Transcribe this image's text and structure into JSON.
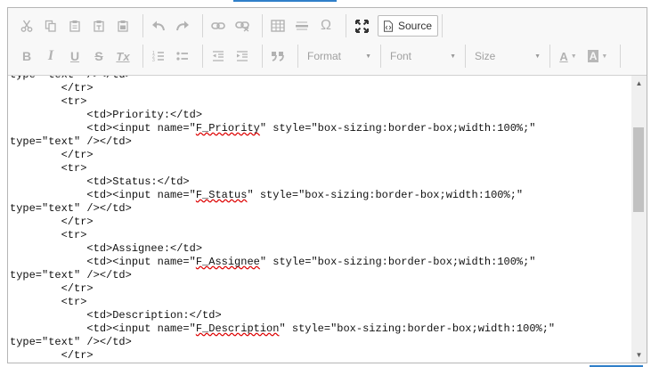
{
  "toolbar": {
    "row1": {
      "clipboard": [
        "cut-icon",
        "copy-icon",
        "paste-icon",
        "paste-text-icon",
        "paste-word-icon"
      ],
      "history": [
        "undo-icon",
        "redo-icon"
      ],
      "links": [
        "link-icon",
        "unlink-icon"
      ],
      "insert": [
        "table-icon",
        "horizontal-rule-icon"
      ],
      "special_char_glyph": "Ω",
      "maximize_icon": "maximize-icon",
      "source_label": "Source"
    },
    "row2": {
      "bold": "B",
      "italic": "I",
      "underline": "U",
      "strike": "S",
      "clear_format": "Tx",
      "format_label": "Format",
      "font_label": "Font",
      "size_label": "Size",
      "text_color_glyph": "A",
      "bg_color_glyph": "A"
    }
  },
  "editor": {
    "mode": "source",
    "lines": [
      {
        "parts": [
          {
            "t": "type=\"text\" /></td>"
          }
        ]
      },
      {
        "parts": [
          {
            "t": "        </tr>"
          }
        ]
      },
      {
        "parts": [
          {
            "t": "        <tr>"
          }
        ]
      },
      {
        "parts": [
          {
            "t": "            <td>Priority:</td>"
          }
        ]
      },
      {
        "parts": [
          {
            "t": "            <td><input name=\""
          },
          {
            "t": "F_Priority",
            "sq": true
          },
          {
            "t": "\" style=\"box-sizing:border-box;width:100%;\""
          }
        ]
      },
      {
        "parts": [
          {
            "t": "type=\"text\" /></td>"
          }
        ]
      },
      {
        "parts": [
          {
            "t": "        </tr>"
          }
        ]
      },
      {
        "parts": [
          {
            "t": "        <tr>"
          }
        ]
      },
      {
        "parts": [
          {
            "t": "            <td>Status:</td>"
          }
        ]
      },
      {
        "parts": [
          {
            "t": "            <td><input name=\""
          },
          {
            "t": "F_Status",
            "sq": true
          },
          {
            "t": "\" style=\"box-sizing:border-box;width:100%;\""
          }
        ]
      },
      {
        "parts": [
          {
            "t": "type=\"text\" /></td>"
          }
        ]
      },
      {
        "parts": [
          {
            "t": "        </tr>"
          }
        ]
      },
      {
        "parts": [
          {
            "t": "        <tr>"
          }
        ]
      },
      {
        "parts": [
          {
            "t": "            <td>Assignee:</td>"
          }
        ]
      },
      {
        "parts": [
          {
            "t": "            <td><input name=\""
          },
          {
            "t": "F_Assignee",
            "sq": true
          },
          {
            "t": "\" style=\"box-sizing:border-box;width:100%;\""
          }
        ]
      },
      {
        "parts": [
          {
            "t": "type=\"text\" /></td>"
          }
        ]
      },
      {
        "parts": [
          {
            "t": "        </tr>"
          }
        ]
      },
      {
        "parts": [
          {
            "t": "        <tr>"
          }
        ]
      },
      {
        "parts": [
          {
            "t": "            <td>Description:</td>"
          }
        ]
      },
      {
        "parts": [
          {
            "t": "            <td><input name=\""
          },
          {
            "t": "F_Description",
            "sq": true
          },
          {
            "t": "\" style=\"box-sizing:border-box;width:100%;\""
          }
        ]
      },
      {
        "parts": [
          {
            "t": "type=\"text\" /></td>"
          }
        ]
      },
      {
        "parts": [
          {
            "t": "        </tr>"
          }
        ]
      }
    ]
  },
  "scrollbar": {
    "position": 0.42,
    "visible_fraction": 0.45
  }
}
